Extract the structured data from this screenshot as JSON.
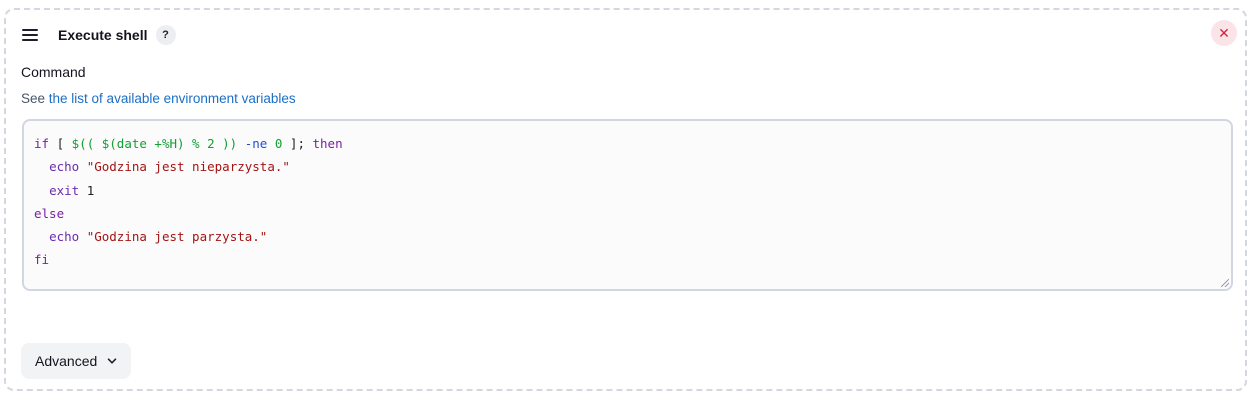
{
  "step": {
    "title": "Execute shell",
    "help_label": "?",
    "close_label": "✕"
  },
  "command": {
    "label": "Command",
    "desc_prefix": "See ",
    "env_link": "the list of available environment variables",
    "code": {
      "l1_if": "if",
      "l1_a": " [ ",
      "l1_sub": "$(( $(date +%H) % 2 ))",
      "l1_b": " ",
      "l1_op": "-ne",
      "l1_c": " ",
      "l1_num": "0",
      "l1_d": " ]; ",
      "l1_then": "then",
      "l2_echo": "echo",
      "l2_str": "\"Godzina jest nieparzysta.\"",
      "l3_exit": "exit",
      "l3_num": "1",
      "l4_else": "else",
      "l5_echo": "echo",
      "l5_str": "\"Godzina jest parzysta.\"",
      "l6_fi": "fi"
    }
  },
  "advanced": {
    "label": "Advanced"
  }
}
